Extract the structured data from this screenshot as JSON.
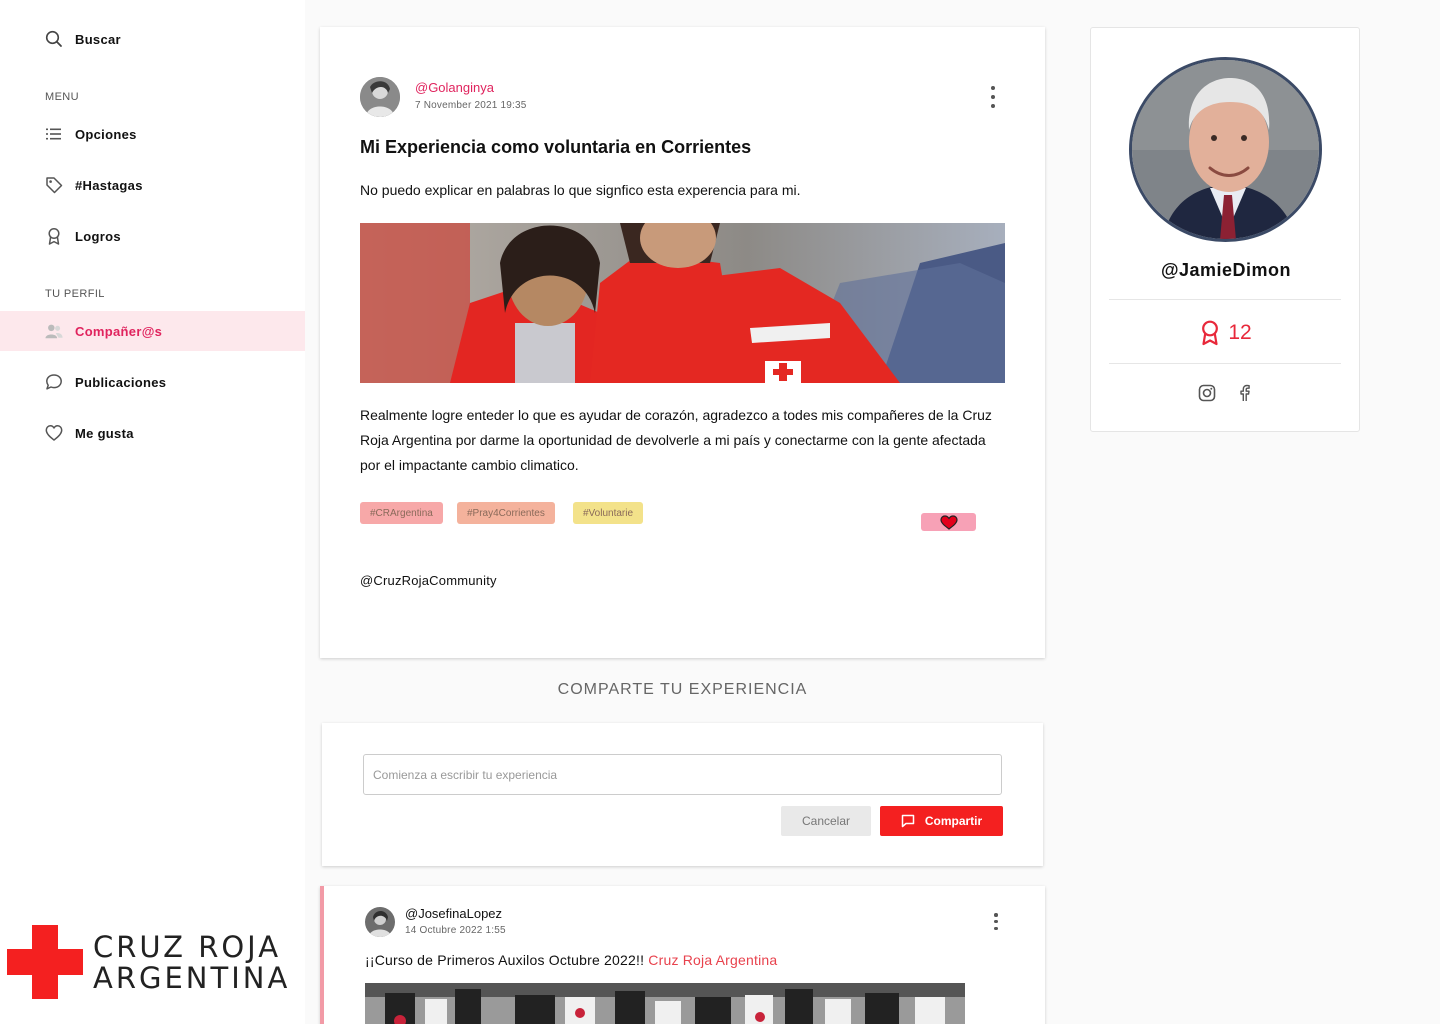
{
  "sidebar": {
    "search_label": "Buscar",
    "menu_section": "MENU",
    "menu_items": [
      {
        "label": "Opciones",
        "icon": "list-icon"
      },
      {
        "label": "#Hastagas",
        "icon": "tag-icon"
      },
      {
        "label": "Logros",
        "icon": "award-icon"
      }
    ],
    "profile_section": "TU PERFIL",
    "profile_items": [
      {
        "label": "Compañer@s",
        "icon": "users-icon",
        "active": true
      },
      {
        "label": "Publicaciones",
        "icon": "chat-bubble-icon"
      },
      {
        "label": "Me gusta",
        "icon": "heart-icon"
      }
    ],
    "logo": {
      "line1": "CRUZ ROJA",
      "line2": "ARGENTINA",
      "color": "#f42020"
    }
  },
  "post": {
    "author": "@Golanginya",
    "date": "7 November 2021 19:35",
    "title": "Mi Experiencia como voluntaria en Corrientes",
    "lead": "No puedo explicar en palabras lo que signfico esta experencia para mi.",
    "body": "Realmente logre enteder lo que es ayudar de corazón, agradezco a todes mis compañeres de la Cruz Roja Argentina por darme la oportunidad de devolverle a mi país y conectarme con la gente afectada por el impactante cambio climatico.",
    "tags": [
      {
        "label": "#CRArgentina",
        "color": "#f7a8a8"
      },
      {
        "label": "#Pray4Corrientes",
        "color": "#f4b29c"
      },
      {
        "label": "#Voluntarie",
        "color": "#f3e28a"
      }
    ],
    "footer": "@CruzRojaCommunity"
  },
  "share": {
    "heading": "COMPARTE TU EXPERIENCIA",
    "placeholder": "Comienza a escribir tu experiencia",
    "cancel_label": "Cancelar",
    "share_label": "Compartir"
  },
  "post2": {
    "author": "@JosefinaLopez",
    "date": "14 Octubre 2022 1:55",
    "text": "¡¡Curso de Primeros Auxilos Octubre 2022!!",
    "link": "Cruz Roja Argentina"
  },
  "profile": {
    "handle": "@JamieDimon",
    "achievements": "12"
  },
  "colors": {
    "accent": "#e0245e",
    "brand_red": "#f42020",
    "active_bg": "#fde8ec"
  }
}
